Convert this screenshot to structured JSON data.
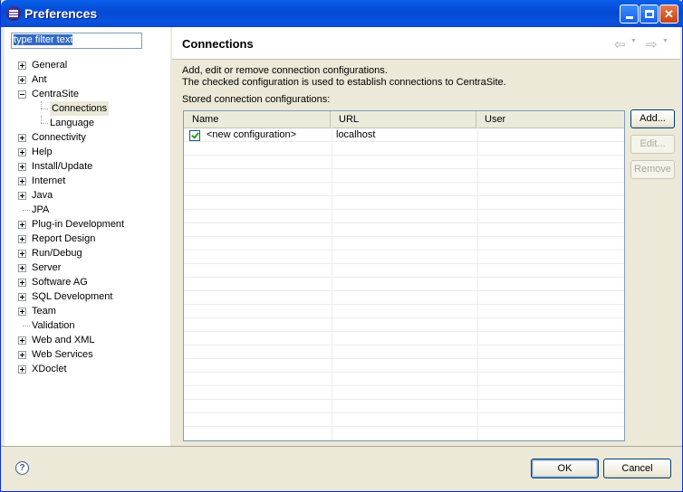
{
  "window": {
    "title": "Preferences"
  },
  "filter": {
    "placeholder": "type filter text"
  },
  "tree": [
    {
      "label": "General",
      "expandable": true,
      "expanded": false,
      "level": 0
    },
    {
      "label": "Ant",
      "expandable": true,
      "expanded": false,
      "level": 0
    },
    {
      "label": "CentraSite",
      "expandable": true,
      "expanded": true,
      "level": 0
    },
    {
      "label": "Connections",
      "expandable": false,
      "level": 1,
      "selected": true
    },
    {
      "label": "Language",
      "expandable": false,
      "level": 1
    },
    {
      "label": "Connectivity",
      "expandable": true,
      "expanded": false,
      "level": 0
    },
    {
      "label": "Help",
      "expandable": true,
      "expanded": false,
      "level": 0
    },
    {
      "label": "Install/Update",
      "expandable": true,
      "expanded": false,
      "level": 0
    },
    {
      "label": "Internet",
      "expandable": true,
      "expanded": false,
      "level": 0
    },
    {
      "label": "Java",
      "expandable": true,
      "expanded": false,
      "level": 0
    },
    {
      "label": "JPA",
      "expandable": false,
      "level": 0
    },
    {
      "label": "Plug-in Development",
      "expandable": true,
      "expanded": false,
      "level": 0
    },
    {
      "label": "Report Design",
      "expandable": true,
      "expanded": false,
      "level": 0
    },
    {
      "label": "Run/Debug",
      "expandable": true,
      "expanded": false,
      "level": 0
    },
    {
      "label": "Server",
      "expandable": true,
      "expanded": false,
      "level": 0
    },
    {
      "label": "Software AG",
      "expandable": true,
      "expanded": false,
      "level": 0
    },
    {
      "label": "SQL Development",
      "expandable": true,
      "expanded": false,
      "level": 0
    },
    {
      "label": "Team",
      "expandable": true,
      "expanded": false,
      "level": 0
    },
    {
      "label": "Validation",
      "expandable": false,
      "level": 0
    },
    {
      "label": "Web and XML",
      "expandable": true,
      "expanded": false,
      "level": 0
    },
    {
      "label": "Web Services",
      "expandable": true,
      "expanded": false,
      "level": 0
    },
    {
      "label": "XDoclet",
      "expandable": true,
      "expanded": false,
      "level": 0
    }
  ],
  "page": {
    "title": "Connections",
    "description_line1": "Add, edit or remove connection configurations.",
    "description_line2": "The checked configuration is used to establish connections to CentraSite.",
    "table_label": "Stored connection configurations:"
  },
  "table": {
    "columns": [
      "Name",
      "URL",
      "User"
    ],
    "rows": [
      {
        "checked": true,
        "name": "<new configuration>",
        "url": "localhost",
        "user": ""
      }
    ]
  },
  "buttons": {
    "add": "Add...",
    "edit": "Edit...",
    "remove": "Remove",
    "ok": "OK",
    "cancel": "Cancel"
  },
  "icons": {
    "back": "back-arrow-icon",
    "forward": "forward-arrow-icon",
    "help": "help-icon"
  }
}
